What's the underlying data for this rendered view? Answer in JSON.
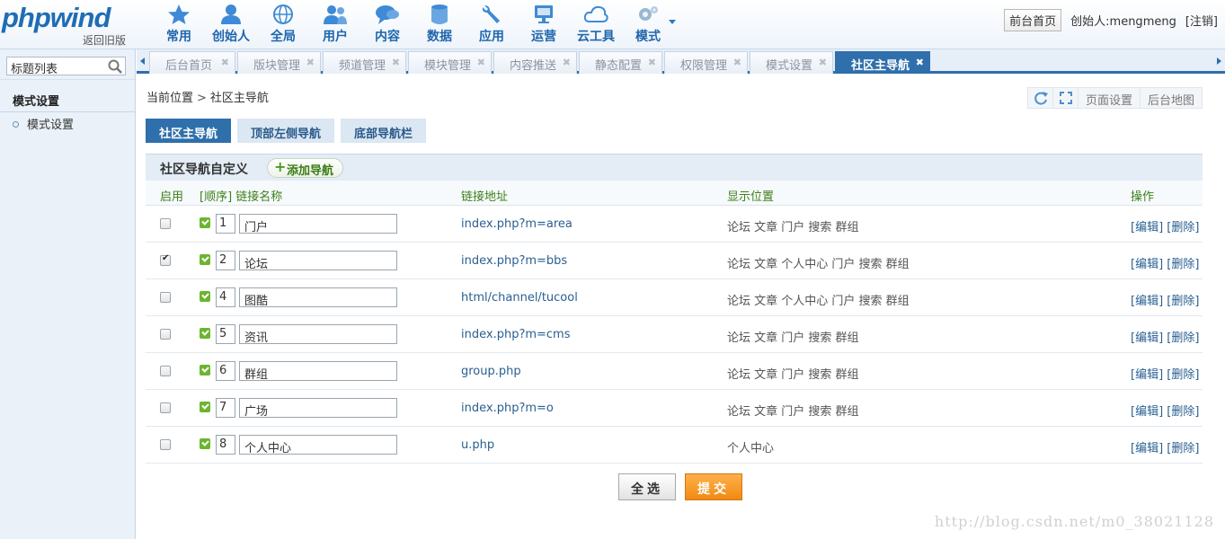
{
  "header": {
    "logo": "phpwind",
    "back_link": "返回旧版",
    "nav": [
      {
        "label": "常用",
        "icon": "star-icon"
      },
      {
        "label": "创始人",
        "icon": "person-icon"
      },
      {
        "label": "全局",
        "icon": "globe-icon"
      },
      {
        "label": "用户",
        "icon": "users-icon"
      },
      {
        "label": "内容",
        "icon": "chat-icon"
      },
      {
        "label": "数据",
        "icon": "database-icon"
      },
      {
        "label": "应用",
        "icon": "wrench-icon"
      },
      {
        "label": "运营",
        "icon": "monitor-icon"
      },
      {
        "label": "云工具",
        "icon": "cloud-icon"
      },
      {
        "label": "模式",
        "icon": "gears-icon"
      }
    ],
    "front_home": "前台首页",
    "creator": "创始人:mengmeng",
    "logout": "[注销]"
  },
  "tabs": [
    {
      "label": "后台首页"
    },
    {
      "label": "版块管理"
    },
    {
      "label": "频道管理"
    },
    {
      "label": "模块管理"
    },
    {
      "label": "内容推送"
    },
    {
      "label": "静态配置"
    },
    {
      "label": "权限管理"
    },
    {
      "label": "模式设置"
    },
    {
      "label": "社区主导航"
    }
  ],
  "sidebar": {
    "search_value": "标题列表",
    "section_title": "模式设置",
    "item": "模式设置"
  },
  "breadcrumb": {
    "root": "当前位置",
    "sep": ">",
    "current": "社区主导航"
  },
  "page_tools": {
    "page_settings": "页面设置",
    "site_map": "后台地图"
  },
  "subtabs": [
    "社区主导航",
    "顶部左侧导航",
    "底部导航栏"
  ],
  "panel": {
    "title": "社区导航自定义",
    "add_button": "添加导航",
    "columns": {
      "enable": "启用",
      "name": "[顺序] 链接名称",
      "url": "链接地址",
      "position": "显示位置",
      "ops": "操作"
    }
  },
  "rows": [
    {
      "enabled": false,
      "order": "1",
      "name": "门户",
      "url": "index.php?m=area",
      "position": "论坛 文章 门户 搜索 群组"
    },
    {
      "enabled": true,
      "order": "2",
      "name": "论坛",
      "url": "index.php?m=bbs",
      "position": "论坛 文章 个人中心 门户 搜索 群组"
    },
    {
      "enabled": false,
      "order": "4",
      "name": "图酷",
      "url": "html/channel/tucool",
      "position": "论坛 文章 个人中心 门户 搜索 群组"
    },
    {
      "enabled": false,
      "order": "5",
      "name": "资讯",
      "url": "index.php?m=cms",
      "position": "论坛 文章 门户 搜索 群组"
    },
    {
      "enabled": false,
      "order": "6",
      "name": "群组",
      "url": "group.php",
      "position": "论坛 文章 门户 搜索 群组"
    },
    {
      "enabled": false,
      "order": "7",
      "name": "广场",
      "url": "index.php?m=o",
      "position": "论坛 文章 门户 搜索 群组"
    },
    {
      "enabled": false,
      "order": "8",
      "name": "个人中心",
      "url": "u.php",
      "position": "个人中心"
    }
  ],
  "ops": {
    "edit": "[编辑]",
    "delete": "[删除]"
  },
  "buttons": {
    "select_all": "全选",
    "submit": "提交"
  },
  "watermark": "http://blog.csdn.net/m0_38021128",
  "colors": {
    "brand": "#1f6db5",
    "active_tab": "#2f6fab",
    "green": "#3c7f18",
    "submit": "#f08a12"
  }
}
